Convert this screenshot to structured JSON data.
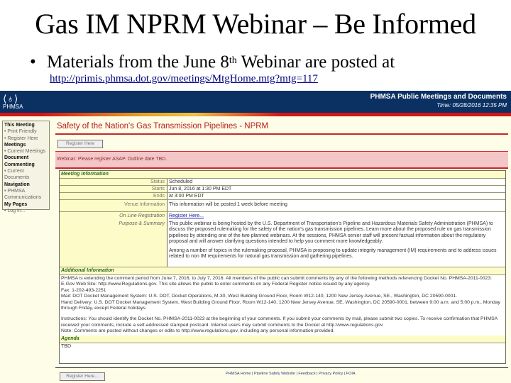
{
  "slide": {
    "title": "Gas IM NPRM Webinar – Be Informed",
    "bullet_pre": "Materials from the June 8",
    "bullet_sup": "th",
    "bullet_post": " Webinar are posted at",
    "url": "http://primis.phmsa.dot.gov/meetings/MtgHome.mtg?mtg=117"
  },
  "browser": {
    "logo_text": "PHMSA",
    "banner_title": "PHMSA Public Meetings and Documents",
    "banner_time": "Time: 05/28/2016 12:35 PM",
    "sidebar": [
      {
        "type": "heading",
        "label": "This Meeting"
      },
      {
        "type": "item",
        "label": "• Print Friendly"
      },
      {
        "type": "item",
        "label": "• Register Here"
      },
      {
        "type": "heading",
        "label": "Meetings"
      },
      {
        "type": "item",
        "label": "• Current Meetings"
      },
      {
        "type": "heading",
        "label": "Document"
      },
      {
        "type": "heading",
        "label": "Commenting"
      },
      {
        "type": "item",
        "label": "• Current Documents"
      },
      {
        "type": "heading",
        "label": "Navigation"
      },
      {
        "type": "item",
        "label": "• PHMSA"
      },
      {
        "type": "item",
        "label": "  Communications"
      },
      {
        "type": "heading",
        "label": "My Pages"
      },
      {
        "type": "item",
        "label": "• Log In..."
      }
    ],
    "page_title": "Safety of the Nation's Gas Transmission Pipelines - NPRM",
    "register_button": "Register Here",
    "alert": "Webinar: Please register ASAP. Outline date TBD.",
    "meeting_info": {
      "header": "Meeting Information",
      "rows": [
        {
          "label": "Status",
          "value": "Scheduled"
        },
        {
          "label": "Starts",
          "value": "Jun 8, 2016 at 1:30 PM EDT"
        },
        {
          "label": "Ends",
          "value": "at 3:00 PM EDT"
        },
        {
          "label": "Venue Information",
          "value": "This information will be posted 1 week before meeting"
        }
      ],
      "online_registration_label": "On Line Registration",
      "online_registration_link": "Register Here...",
      "purpose_label": "Purpose & Summary",
      "purpose_p1": "This public webinar is being hosted by the U.S. Department of Transportation's Pipeline and Hazardous Materials Safety Administration (PHMSA) to discuss the proposed rulemaking for the safety of the nation's gas transmission pipelines. Learn more about the proposed rule on gas transmission pipelines by attending one of the two planned webinars. At the sessions, PHMSA senior staff will present factual information about the regulatory proposal and will answer clarifying questions intended to help you comment more knowledgeably.",
      "purpose_p2": "Among a number of topics in the rulemaking proposal, PHMSA is proposing to update integrity management (IM) requirements and to address issues related to non IM requirements for natural gas transmission and gathering pipelines."
    },
    "additional_info": {
      "header": "Additional Information",
      "lines": [
        "PHMSA is extending the comment period from June 7, 2016, to July 7, 2016. All members of the public can submit comments by any of the following methods referencing Docket No. PHMSA-2011-0023:",
        "E-Gov Web Site: http://www.Regulations.gov. This site allows the public to enter comments on any Federal Register notice issued by any agency.",
        "Fax: 1-202-493-2251",
        "Mail: DOT Docket Management System: U.S. DOT, Docket Operations, M-30, West Building Ground Floor, Room W12-140, 1200 New Jersey Avenue, SE., Washington, DC 20590-0001.",
        "Hand Delivery: U.S. DOT Docket Management System, West Building Ground Floor, Room W12-140, 1200 New Jersey Avenue, SE, Washington, DC 20590-0001, between 9:00 a.m. and 5:00 p.m., Monday through Friday, except Federal holidays."
      ],
      "instructions": "Instructions: You should identify the Docket No. PHMSA-2011-0023 at the beginning of your comments. If you submit your comments by mail, please submit two copies. To receive confirmation that PHMSA received your comments, include a self-addressed stamped postcard. Internet users may submit comments to the Docket at http://www.regulations.gov",
      "note": "Note: Comments are posted without changes or edits to http://www.regulations.gov, including any personal information provided."
    },
    "agenda": {
      "header": "Agenda",
      "value": "TBD"
    },
    "register_button_bottom": "Register Here...",
    "footer_links": "PHMSA Home | Pipeline Safety Website | Feedback | Privacy Policy | FOIA"
  }
}
